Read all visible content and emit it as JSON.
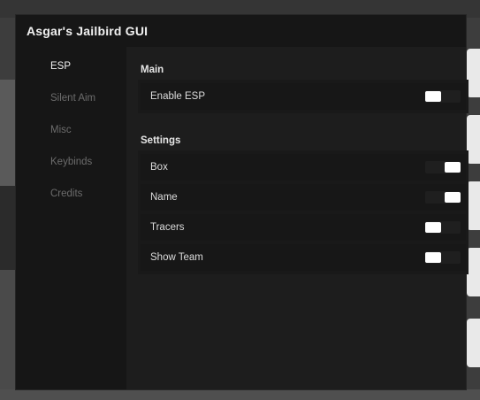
{
  "window": {
    "title": "Asgar's Jailbird GUI"
  },
  "sidebar": {
    "items": [
      {
        "label": "ESP",
        "active": true
      },
      {
        "label": "Silent Aim",
        "active": false
      },
      {
        "label": "Misc",
        "active": false
      },
      {
        "label": "Keybinds",
        "active": false
      },
      {
        "label": "Credits",
        "active": false
      }
    ]
  },
  "sections": {
    "main": {
      "title": "Main",
      "options": [
        {
          "label": "Enable ESP",
          "enabled": false
        }
      ]
    },
    "settings": {
      "title": "Settings",
      "options": [
        {
          "label": "Box",
          "enabled": true
        },
        {
          "label": "Name",
          "enabled": true
        },
        {
          "label": "Tracers",
          "enabled": false
        },
        {
          "label": "Show Team",
          "enabled": false
        }
      ]
    }
  },
  "colors": {
    "window_bg": "#161616",
    "content_bg": "#1d1d1d",
    "active_text": "#f0f0f0",
    "inactive_text": "#6c6c6c",
    "toggle_knob": "#ffffff"
  }
}
